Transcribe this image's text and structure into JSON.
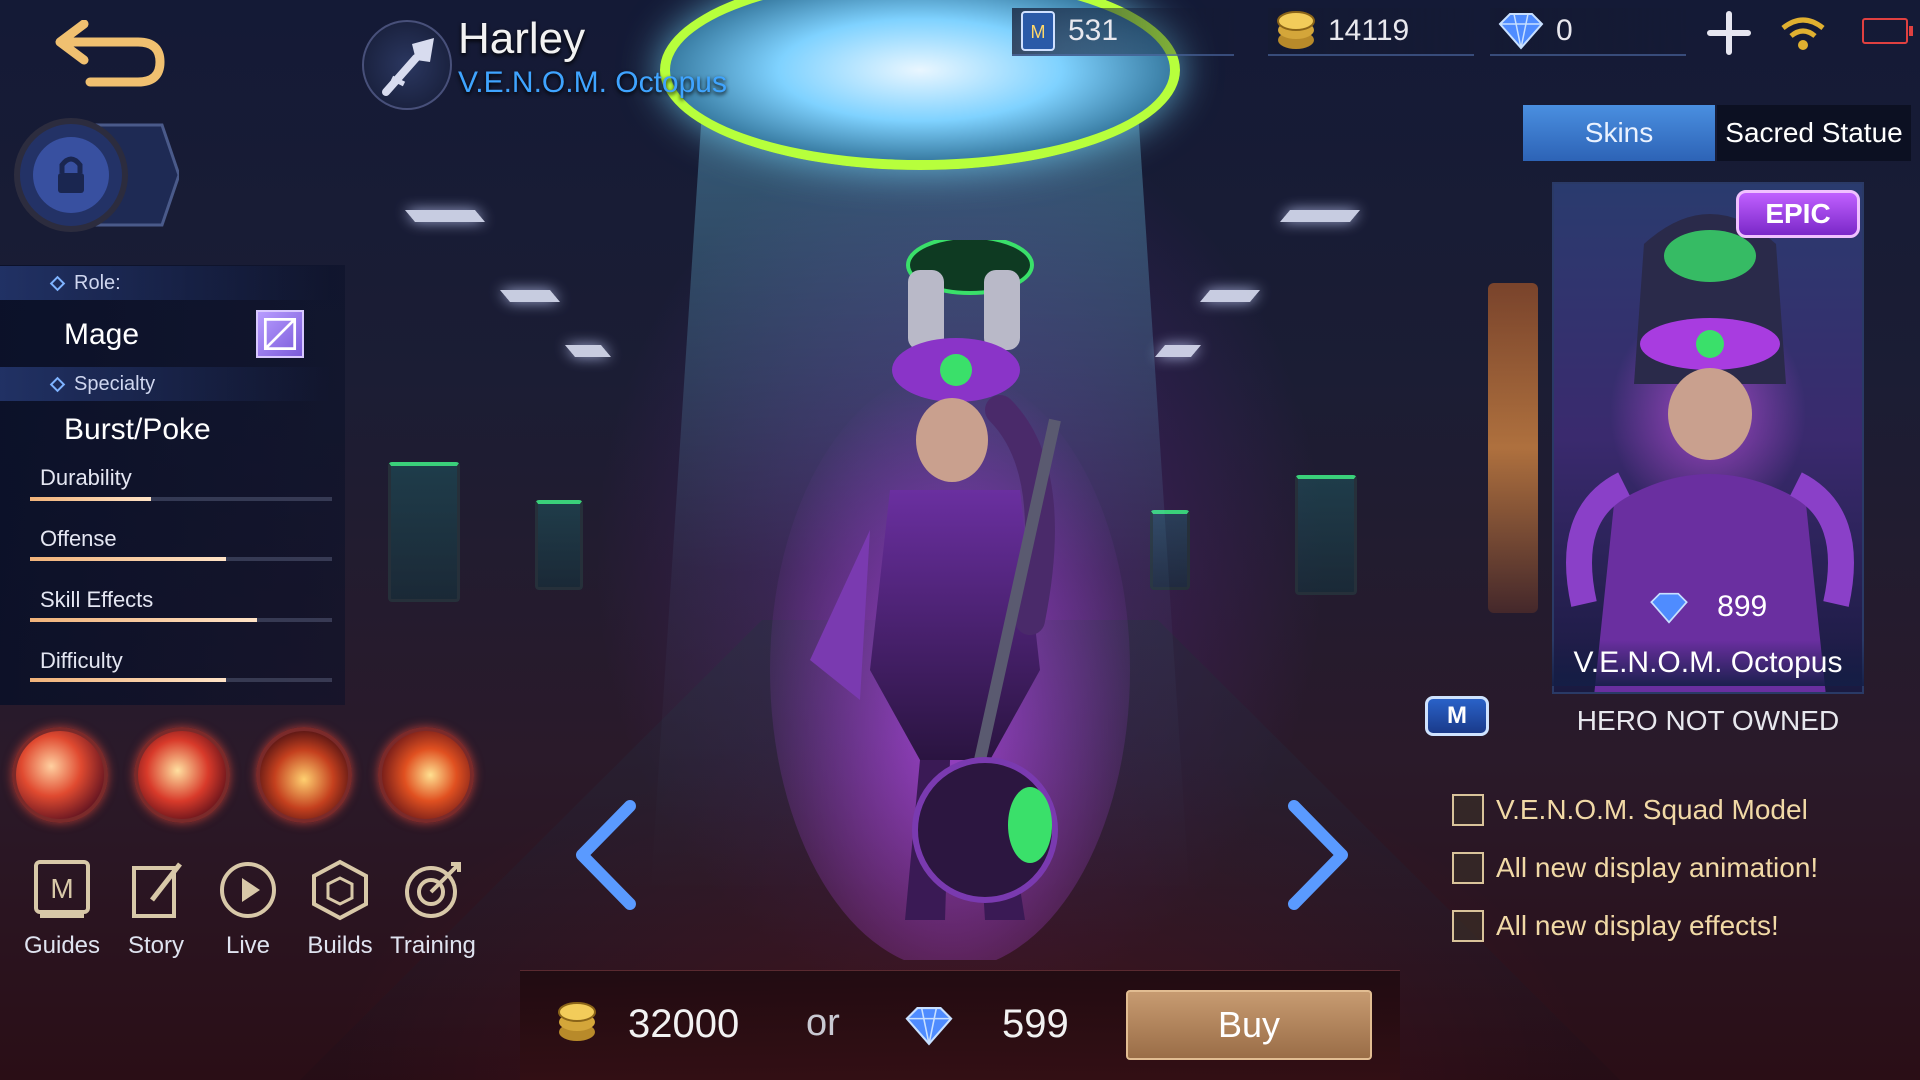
{
  "header": {
    "hero_name": "Harley",
    "skin_name": "V.E.N.O.M. Octopus"
  },
  "currencies": {
    "tickets": "531",
    "battle_points": "14119",
    "diamonds": "0"
  },
  "left": {
    "role_label": "Role:",
    "role_value": "Mage",
    "specialty_label": "Specialty",
    "specialty_value": "Burst/Poke",
    "stats": [
      {
        "label": "Durability",
        "value": 0.4
      },
      {
        "label": "Offense",
        "value": 0.65
      },
      {
        "label": "Skill Effects",
        "value": 0.75
      },
      {
        "label": "Difficulty",
        "value": 0.65
      }
    ],
    "menu": [
      {
        "label": "Guides",
        "icon": "guides-icon"
      },
      {
        "label": "Story",
        "icon": "story-icon"
      },
      {
        "label": "Live",
        "icon": "live-icon"
      },
      {
        "label": "Builds",
        "icon": "builds-icon"
      },
      {
        "label": "Training",
        "icon": "training-icon"
      }
    ]
  },
  "purchase": {
    "bp_price": "32000",
    "or_text": "or",
    "diamond_price": "599",
    "buy_label": "Buy"
  },
  "right": {
    "tabs": [
      {
        "label": "Skins",
        "active": true
      },
      {
        "label": "Sacred Statue",
        "active": false
      }
    ],
    "card": {
      "badge": "EPIC",
      "price": "899",
      "name": "V.E.N.O.M. Octopus"
    },
    "m_badge": "M",
    "status": "HERO NOT OWNED",
    "features": [
      "V.E.N.O.M. Squad Model",
      "All new display animation!",
      "All new display effects!"
    ]
  },
  "colors": {
    "accent_blue": "#3fa4ff",
    "buy_button": "#b5845c",
    "epic_purple": "#9a3cf0",
    "feature_gold": "#f1d9a6"
  }
}
